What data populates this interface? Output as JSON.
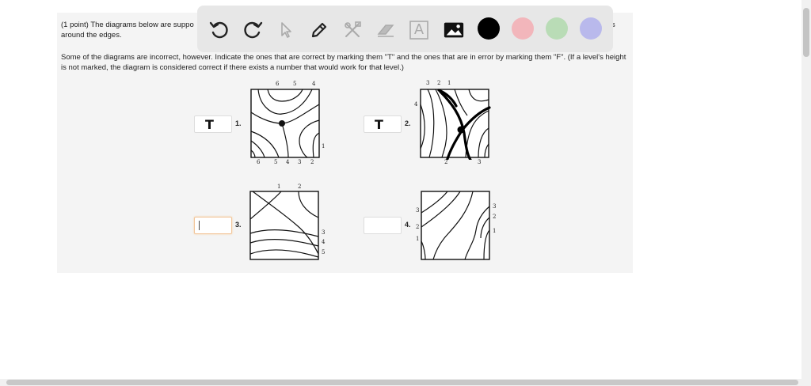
{
  "problem": {
    "intro_visible": "(1 point) The diagrams below are suppo",
    "intro_line2": "around the edges.",
    "intro_right_fragment": "s",
    "instructions": "Some of the diagrams are incorrect, however. Indicate the ones that are correct by marking them \"T\" and the ones that are in error by marking them \"F\". (If a level's height is not marked, the diagram is considered correct if there exists a number that would work for that level.)"
  },
  "toolbar": {
    "tools": [
      "undo-icon",
      "redo-icon",
      "pointer-icon",
      "pen-icon",
      "tools-icon",
      "eraser-icon",
      "text-icon",
      "image-icon"
    ],
    "text_tool_glyph": "A",
    "colors": [
      "#000000",
      "#f2b6bb",
      "#b9dcb6",
      "#b9b9ec"
    ]
  },
  "diagrams": [
    {
      "number": "1.",
      "answer": "T",
      "top_labels": [
        "6",
        "5",
        "4"
      ],
      "bottom_labels": [
        "6",
        "5",
        "4",
        "3",
        "2"
      ],
      "right_labels": [
        "1"
      ]
    },
    {
      "number": "2.",
      "answer": "T",
      "top_labels": [
        "3",
        "2",
        "1"
      ],
      "left_labels": [
        "4"
      ],
      "bottom_labels": [
        "2",
        "3"
      ]
    },
    {
      "number": "3.",
      "answer": "",
      "top_labels": [
        "1",
        "2"
      ],
      "right_labels": [
        "3",
        "4",
        "5"
      ]
    },
    {
      "number": "4.",
      "answer": "",
      "left_labels": [
        "3",
        "2",
        "1"
      ],
      "right_labels": [
        "3",
        "2",
        "1"
      ]
    }
  ]
}
